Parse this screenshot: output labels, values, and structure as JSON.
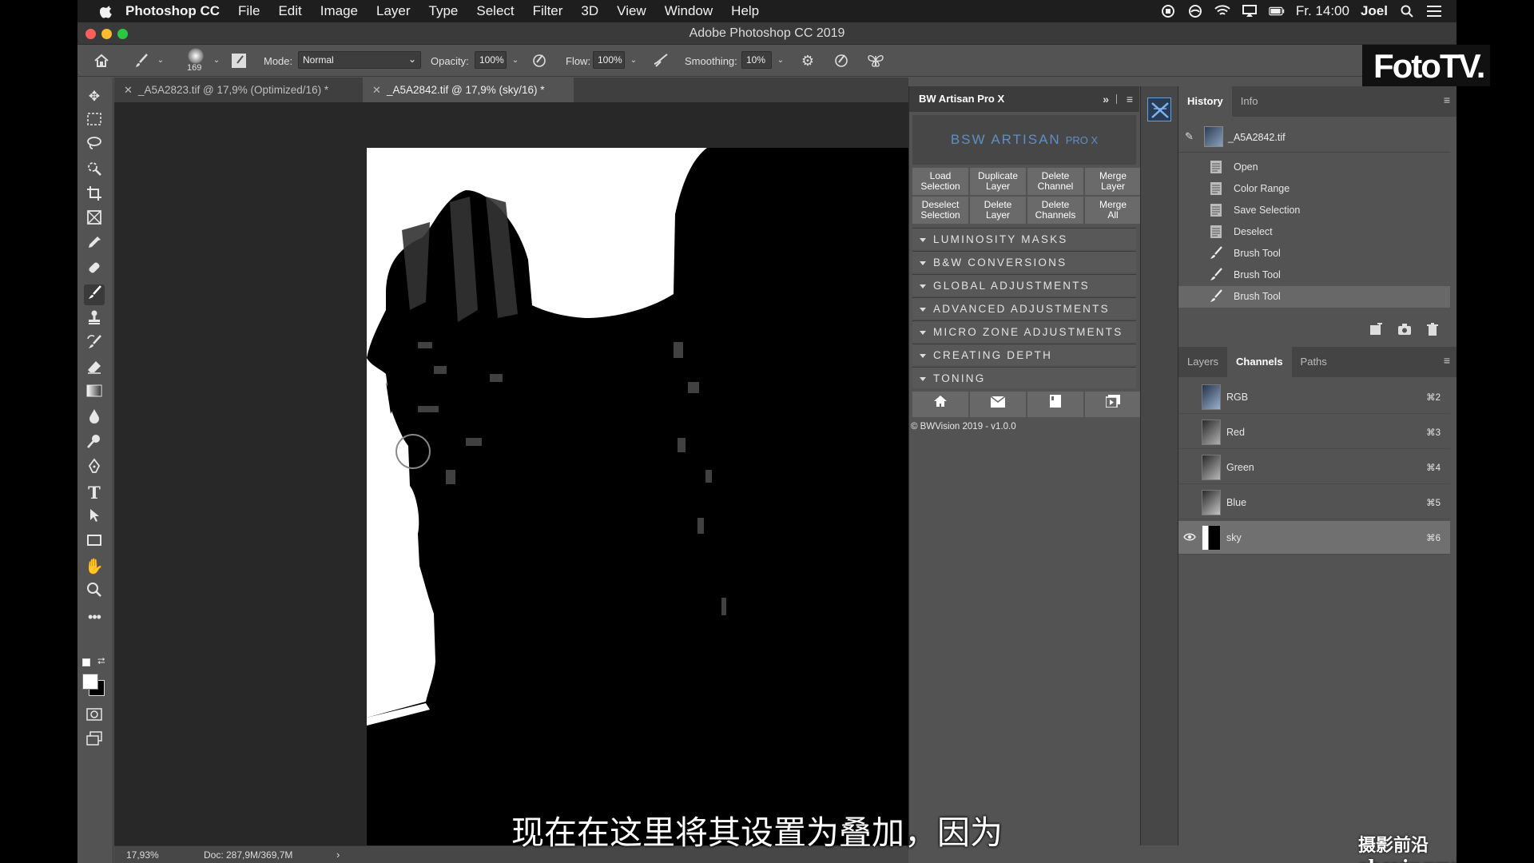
{
  "menubar": {
    "app_name": "Photoshop CC",
    "items": [
      "File",
      "Edit",
      "Image",
      "Layer",
      "Type",
      "Select",
      "Filter",
      "3D",
      "View",
      "Window",
      "Help"
    ],
    "clock": "Fr. 14:00",
    "user": "Joel"
  },
  "window": {
    "title": "Adobe Photoshop CC 2019"
  },
  "options": {
    "brush_size": "169",
    "mode_label": "Mode:",
    "mode_value": "Normal",
    "opacity_label": "Opacity:",
    "opacity_value": "100%",
    "flow_label": "Flow:",
    "flow_value": "100%",
    "smoothing_label": "Smoothing:",
    "smoothing_value": "10%"
  },
  "doc_tabs": [
    {
      "label": "_A5A2823.tif @ 17,9% (Optimized/16) *"
    },
    {
      "label": "_A5A2842.tif @ 17,9% (sky/16) *"
    }
  ],
  "status": {
    "zoom": "17,93%",
    "doc": "Doc: 287,9M/369,7M"
  },
  "bw_panel": {
    "title": "BW Artisan Pro X",
    "logo_text": "BSW ARTISAN",
    "logo_badge": "PRO X",
    "buttons": [
      [
        "Load",
        "Selection"
      ],
      [
        "Duplicate",
        "Layer"
      ],
      [
        "Delete",
        "Channel"
      ],
      [
        "Merge",
        "Layer"
      ],
      [
        "Deselect",
        "Selection"
      ],
      [
        "Delete",
        "Layer"
      ],
      [
        "Delete",
        "Channels"
      ],
      [
        "Merge",
        "All"
      ]
    ],
    "sections": [
      "LUMINOSITY MASKS",
      "B&W CONVERSIONS",
      "GLOBAL ADJUSTMENTS",
      "ADVANCED ADJUSTMENTS",
      "MICRO ZONE ADJUSTMENTS",
      "CREATING DEPTH",
      "TONING"
    ],
    "copyright": "© BWVision 2019 - v1.0.0"
  },
  "history_panel": {
    "tabs": [
      "History",
      "Info"
    ],
    "snapshot": "_A5A2842.tif",
    "items": [
      "Open",
      "Color Range",
      "Save Selection",
      "Deselect",
      "Brush Tool",
      "Brush Tool",
      "Brush Tool"
    ]
  },
  "channels_panel": {
    "tabs": [
      "Layers",
      "Channels",
      "Paths"
    ],
    "channels": [
      {
        "name": "RGB",
        "shortcut": "⌘2"
      },
      {
        "name": "Red",
        "shortcut": "⌘3"
      },
      {
        "name": "Green",
        "shortcut": "⌘4"
      },
      {
        "name": "Blue",
        "shortcut": "⌘5"
      },
      {
        "name": "sky",
        "shortcut": "⌘6"
      }
    ]
  },
  "overlay": {
    "logo": "FotoTV.",
    "subtitle": "现在在这里将其设置为叠加，因为",
    "watermark": "摄影前沿 sheyingzyz.com"
  }
}
